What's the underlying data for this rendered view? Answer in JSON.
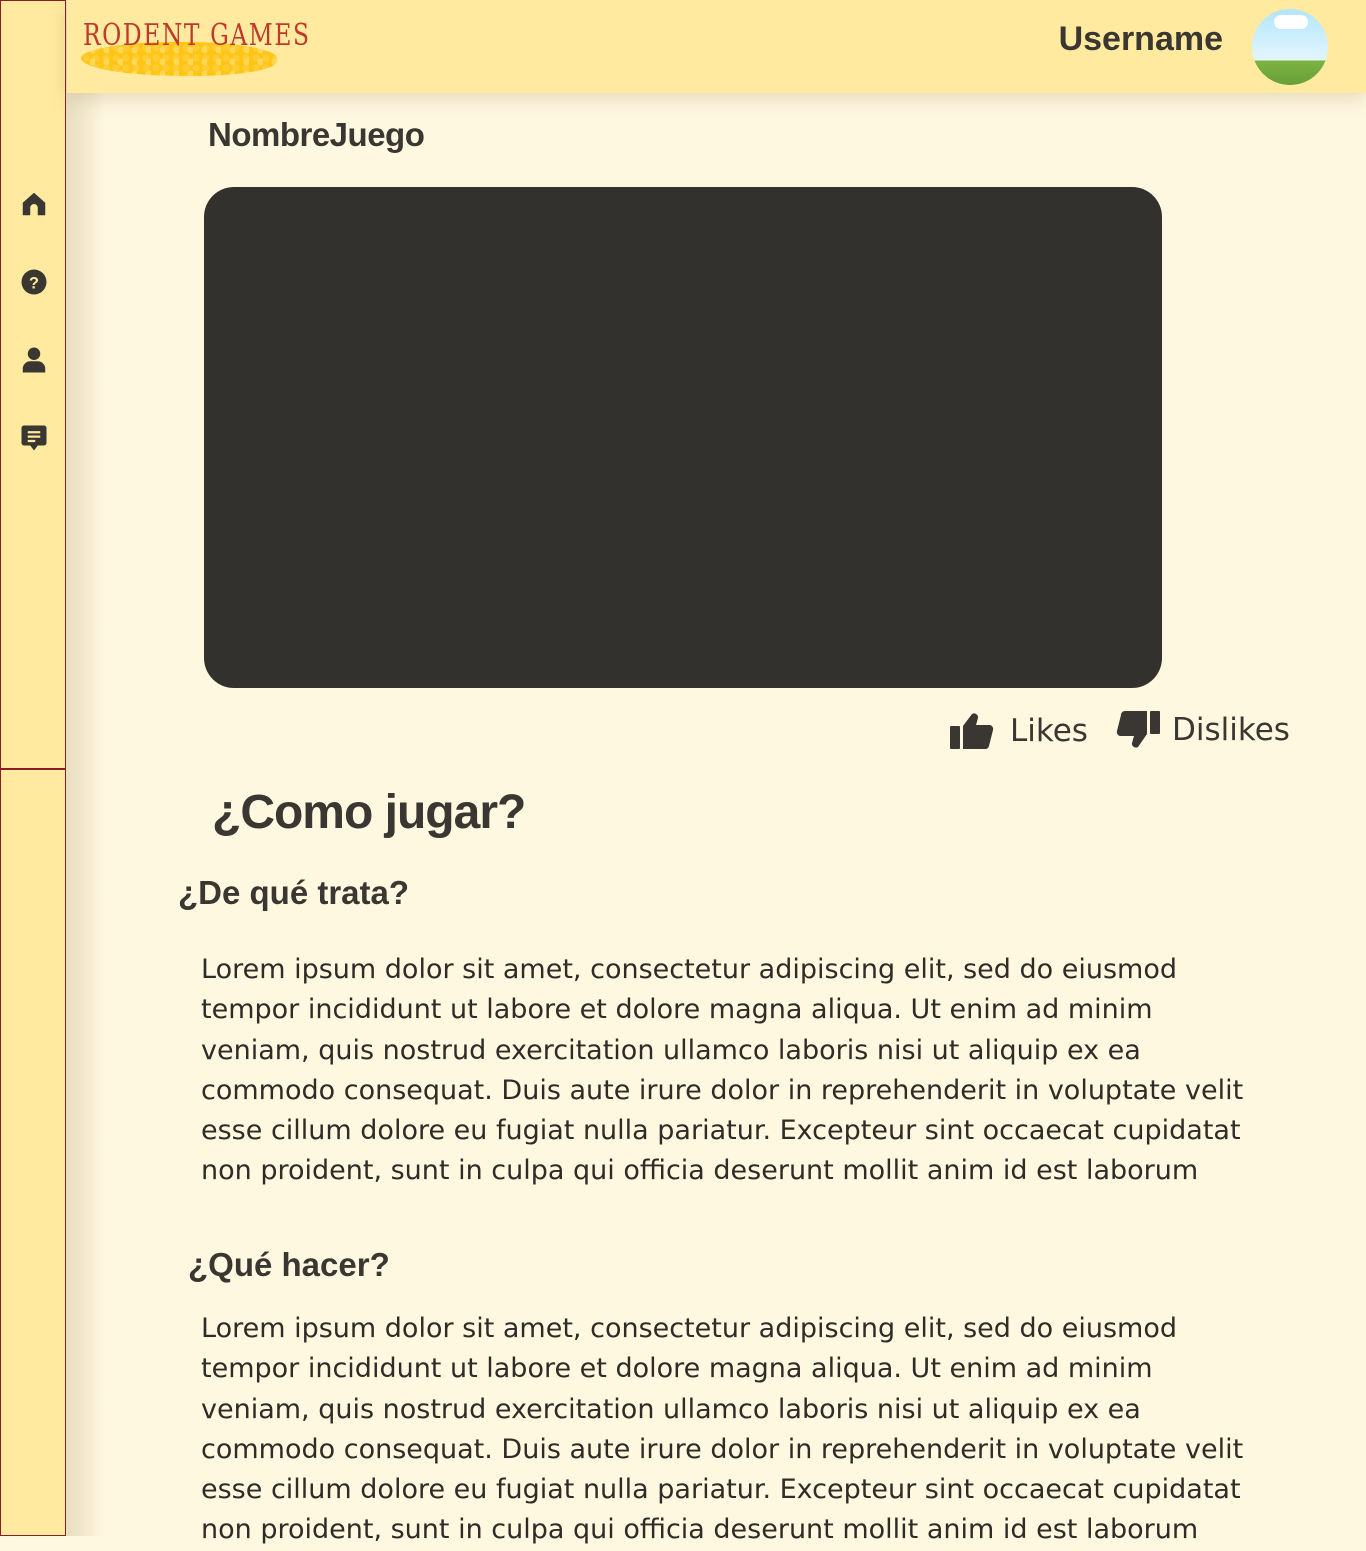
{
  "header": {
    "logo_text": "RODENT GAMES",
    "username": "Username"
  },
  "sidebar": {
    "items": [
      {
        "icon": "home-icon"
      },
      {
        "icon": "help-icon"
      },
      {
        "icon": "user-icon"
      },
      {
        "icon": "chat-icon"
      }
    ]
  },
  "game": {
    "title": "NombreJuego",
    "likes_label": "Likes",
    "dislikes_label": "Dislikes"
  },
  "instructions": {
    "title": "¿Como jugar?",
    "sections": [
      {
        "heading": "¿De qué trata?",
        "body": "Lorem ipsum dolor sit amet, consectetur adipiscing elit, sed do eiusmod tempor incididunt ut labore et dolore magna aliqua. Ut enim ad minim veniam, quis nostrud exercitation ullamco laboris nisi ut aliquip ex ea commodo consequat. Duis aute irure dolor in reprehenderit in voluptate velit esse cillum dolore eu fugiat nulla pariatur. Excepteur sint occaecat cupidatat non proident, sunt in culpa qui officia deserunt mollit anim id est laborum"
      },
      {
        "heading": "¿Qué hacer?",
        "body": "Lorem ipsum dolor sit amet, consectetur adipiscing elit, sed do eiusmod tempor incididunt ut labore et dolore magna aliqua. Ut enim ad minim veniam, quis nostrud exercitation ullamco laboris nisi ut aliquip ex ea commodo consequat. Duis aute irure dolor in reprehenderit in voluptate velit esse cillum dolore eu fugiat nulla pariatur. Excepteur sint occaecat cupidatat non proident, sunt in culpa qui officia deserunt mollit anim id est laborum"
      }
    ]
  },
  "colors": {
    "header_bg": "#ffeaa0",
    "page_bg": "#fff8e1",
    "text": "#3a3631",
    "game_frame": "#33312d",
    "logo_red": "#c0392b",
    "sidebar_border": "#8a1c2a"
  }
}
